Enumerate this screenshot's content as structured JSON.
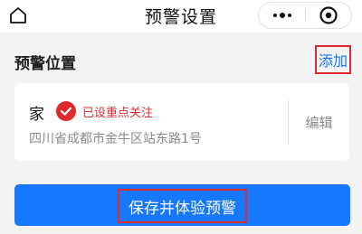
{
  "navbar": {
    "title": "预警设置",
    "home_icon": "home-icon",
    "more_icon": "more-dots-icon",
    "close_icon": "close-circle-icon"
  },
  "section": {
    "title": "预警位置",
    "add_label": "添加"
  },
  "location": {
    "name": "家",
    "status_icon": "check-circle-icon",
    "status_label": "已设重点关注",
    "address": "四川省成都市金牛区站东路1号",
    "edit_label": "编辑"
  },
  "actions": {
    "save_label": "保存并体验预警"
  },
  "colors": {
    "accent": "#1677ff",
    "highlight": "#e0282e",
    "background": "#f3f3f3"
  }
}
